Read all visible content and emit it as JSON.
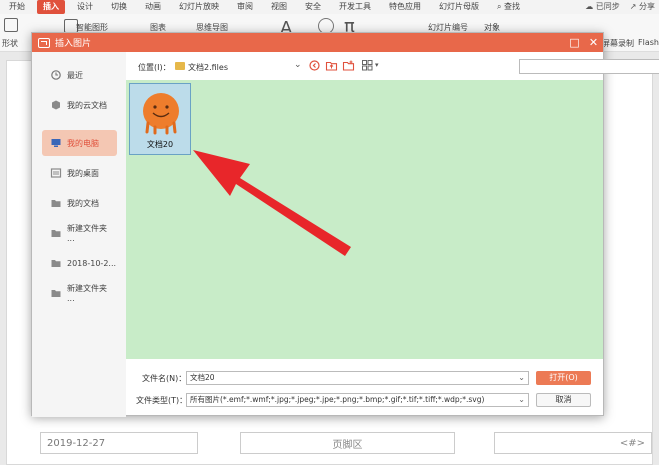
{
  "menubar": {
    "items": [
      "开始",
      "插入",
      "设计",
      "切换",
      "动画",
      "幻灯片放映",
      "审阅",
      "视图",
      "安全",
      "开发工具",
      "特色应用",
      "幻灯片母版"
    ],
    "active": "插入",
    "search": "查找",
    "sync": "已同步",
    "share": "分享"
  },
  "toolbar": {
    "shape": "形状",
    "smart_graphic": "智能图形",
    "chart": "图表",
    "mindmap": "思维导图",
    "slide_number": "幻灯片编号",
    "object": "对象",
    "screen_record": "屏幕录制",
    "flash": "Flash"
  },
  "slide": {
    "date": "2019-12-27",
    "footer": "页脚区",
    "page_number": "<#>"
  },
  "dialog": {
    "title": "插入图片",
    "location_label": "位置(I)：",
    "location_value": "文档2.files",
    "search_placeholder": "",
    "sidebar": [
      {
        "label": "最近",
        "icon": "clock-icon"
      },
      {
        "label": "我的云文档",
        "icon": "cloud-icon"
      },
      {
        "label": "我的电脑",
        "icon": "computer-icon"
      },
      {
        "label": "我的桌面",
        "icon": "desktop-icon"
      },
      {
        "label": "我的文档",
        "icon": "folder-icon"
      },
      {
        "label": "新建文件夹 ...",
        "icon": "folder-icon"
      },
      {
        "label": "2018-10-2...",
        "icon": "folder-icon"
      },
      {
        "label": "新建文件夹 ...",
        "icon": "folder-icon"
      }
    ],
    "active_sidebar": "我的电脑",
    "files": [
      {
        "name": "文档20"
      }
    ],
    "filename_label": "文件名(N)：",
    "filename_value": "文档20",
    "filetype_label": "文件类型(T)：",
    "filetype_value": "所有图片(*.emf;*.wmf;*.jpg;*.jpeg;*.jpe;*.png;*.bmp;*.gif;*.tif;*.tiff;*.wdp;*.svg)",
    "open_button": "打开(O)",
    "cancel_button": "取消"
  },
  "colors": {
    "accent": "#e8684a",
    "file_area": "#c8ecc8",
    "arrow": "#e8262a"
  }
}
